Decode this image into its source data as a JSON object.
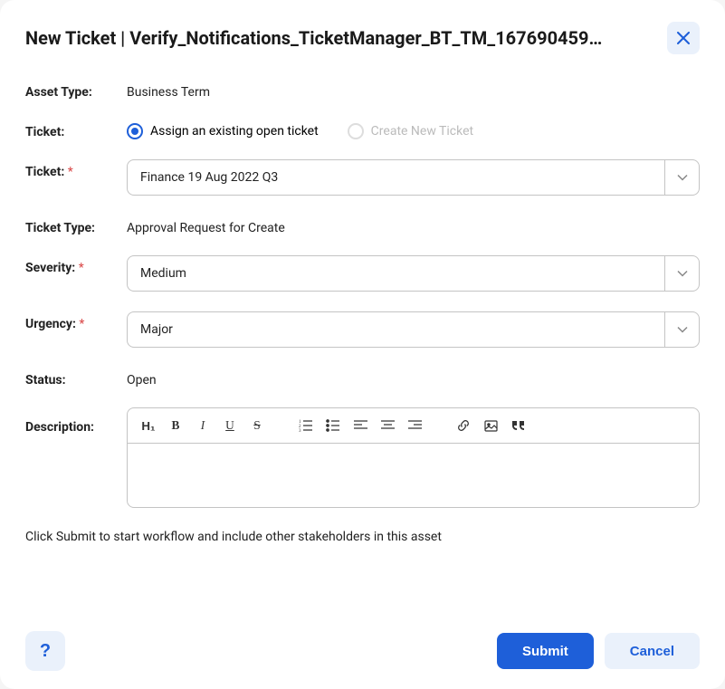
{
  "header": {
    "title": "New Ticket | Verify_Notifications_TicketManager_BT_TM_167690459…"
  },
  "form": {
    "asset_type": {
      "label": "Asset Type:",
      "value": "Business Term"
    },
    "ticket_mode": {
      "label": "Ticket:",
      "options": [
        {
          "label": "Assign an existing open ticket",
          "selected": true,
          "disabled": false
        },
        {
          "label": "Create New Ticket",
          "selected": false,
          "disabled": true
        }
      ]
    },
    "ticket_select": {
      "label": "Ticket:",
      "required": "*",
      "value": "Finance 19 Aug 2022 Q3"
    },
    "ticket_type": {
      "label": "Ticket Type:",
      "value": "Approval Request for Create"
    },
    "severity": {
      "label": "Severity:",
      "required": "*",
      "value": "Medium"
    },
    "urgency": {
      "label": "Urgency:",
      "required": "*",
      "value": "Major"
    },
    "status": {
      "label": "Status:",
      "value": "Open"
    },
    "description": {
      "label": "Description:"
    },
    "hint": "Click Submit to start workflow and include other stakeholders in this asset"
  },
  "editor_toolbar": {
    "h1": "H₁",
    "bold": "B",
    "italic": "I",
    "underline": "U",
    "strike": "S"
  },
  "footer": {
    "help": "?",
    "submit": "Submit",
    "cancel": "Cancel"
  }
}
